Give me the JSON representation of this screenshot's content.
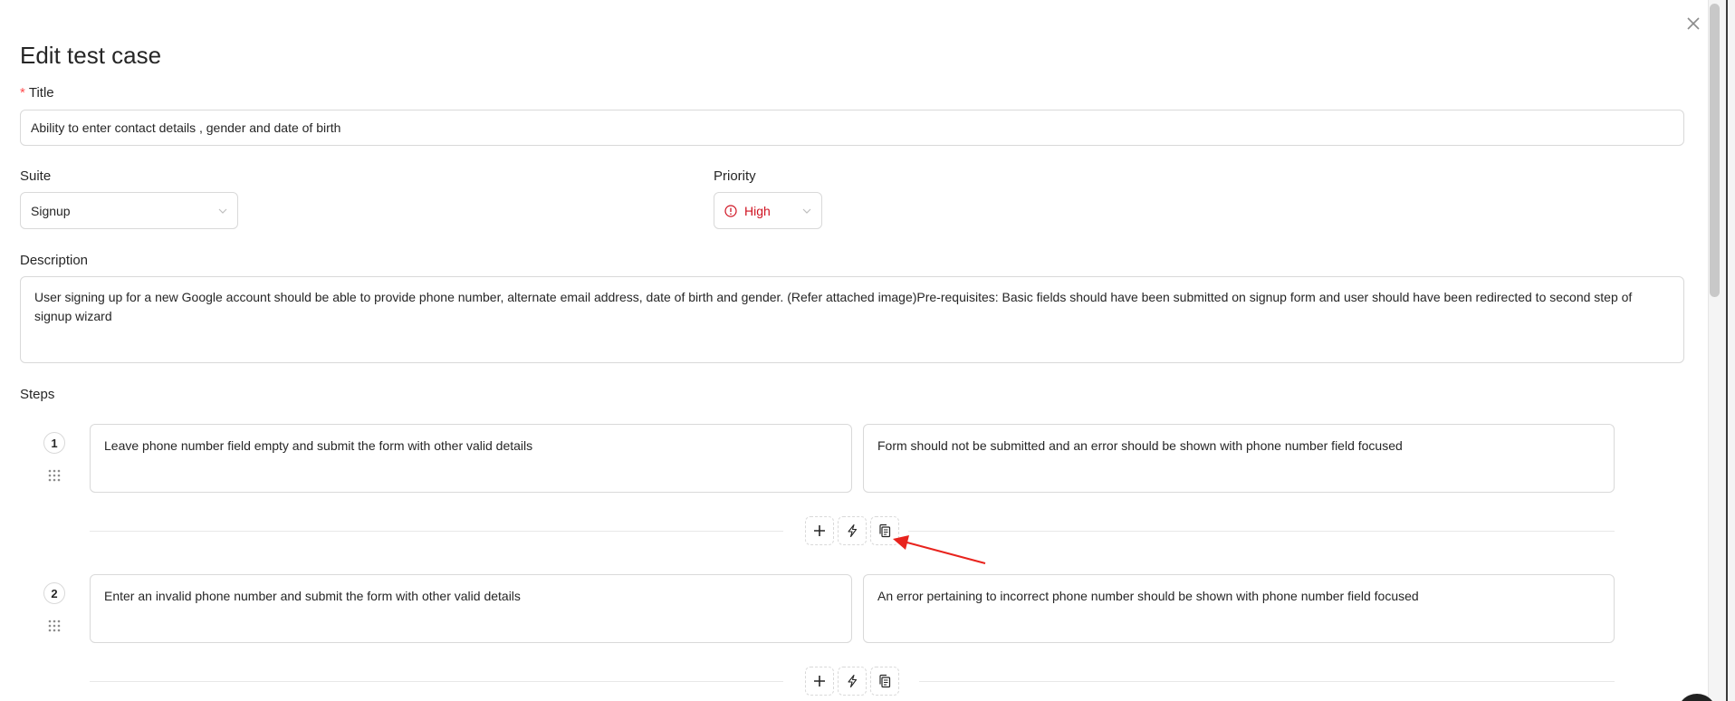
{
  "modal": {
    "title": "Edit test case",
    "close_icon": "close-icon"
  },
  "form": {
    "title_label": "Title",
    "title_required_mark": "*",
    "title_value": "Ability to enter contact details , gender and date of birth",
    "suite_label": "Suite",
    "suite_value": "Signup",
    "priority_label": "Priority",
    "priority_value": "High",
    "priority_color": "#cf1322",
    "description_label": "Description",
    "description_value": "User signing up for a new Google account should be able to provide phone number, alternate email address, date of birth and gender. (Refer attached image)Pre-requisites: Basic fields should have been submitted on signup form and user should have been redirected to second step of signup wizard",
    "steps_label": "Steps"
  },
  "steps": [
    {
      "number": "1",
      "action": "Leave phone number field empty and submit the form with other valid details",
      "expected": "Form should not be submitted and an error should be shown with phone number field focused"
    },
    {
      "number": "2",
      "action": "Enter an invalid phone number and submit the form with other valid details",
      "expected": "An error pertaining to incorrect phone number should be shown with phone number field focused"
    }
  ],
  "step_actions": {
    "add_icon": "plus-icon",
    "generate_icon": "lightning-icon",
    "clone_icon": "copy-icon"
  },
  "annotation": {
    "arrow_color": "#e8231d"
  }
}
